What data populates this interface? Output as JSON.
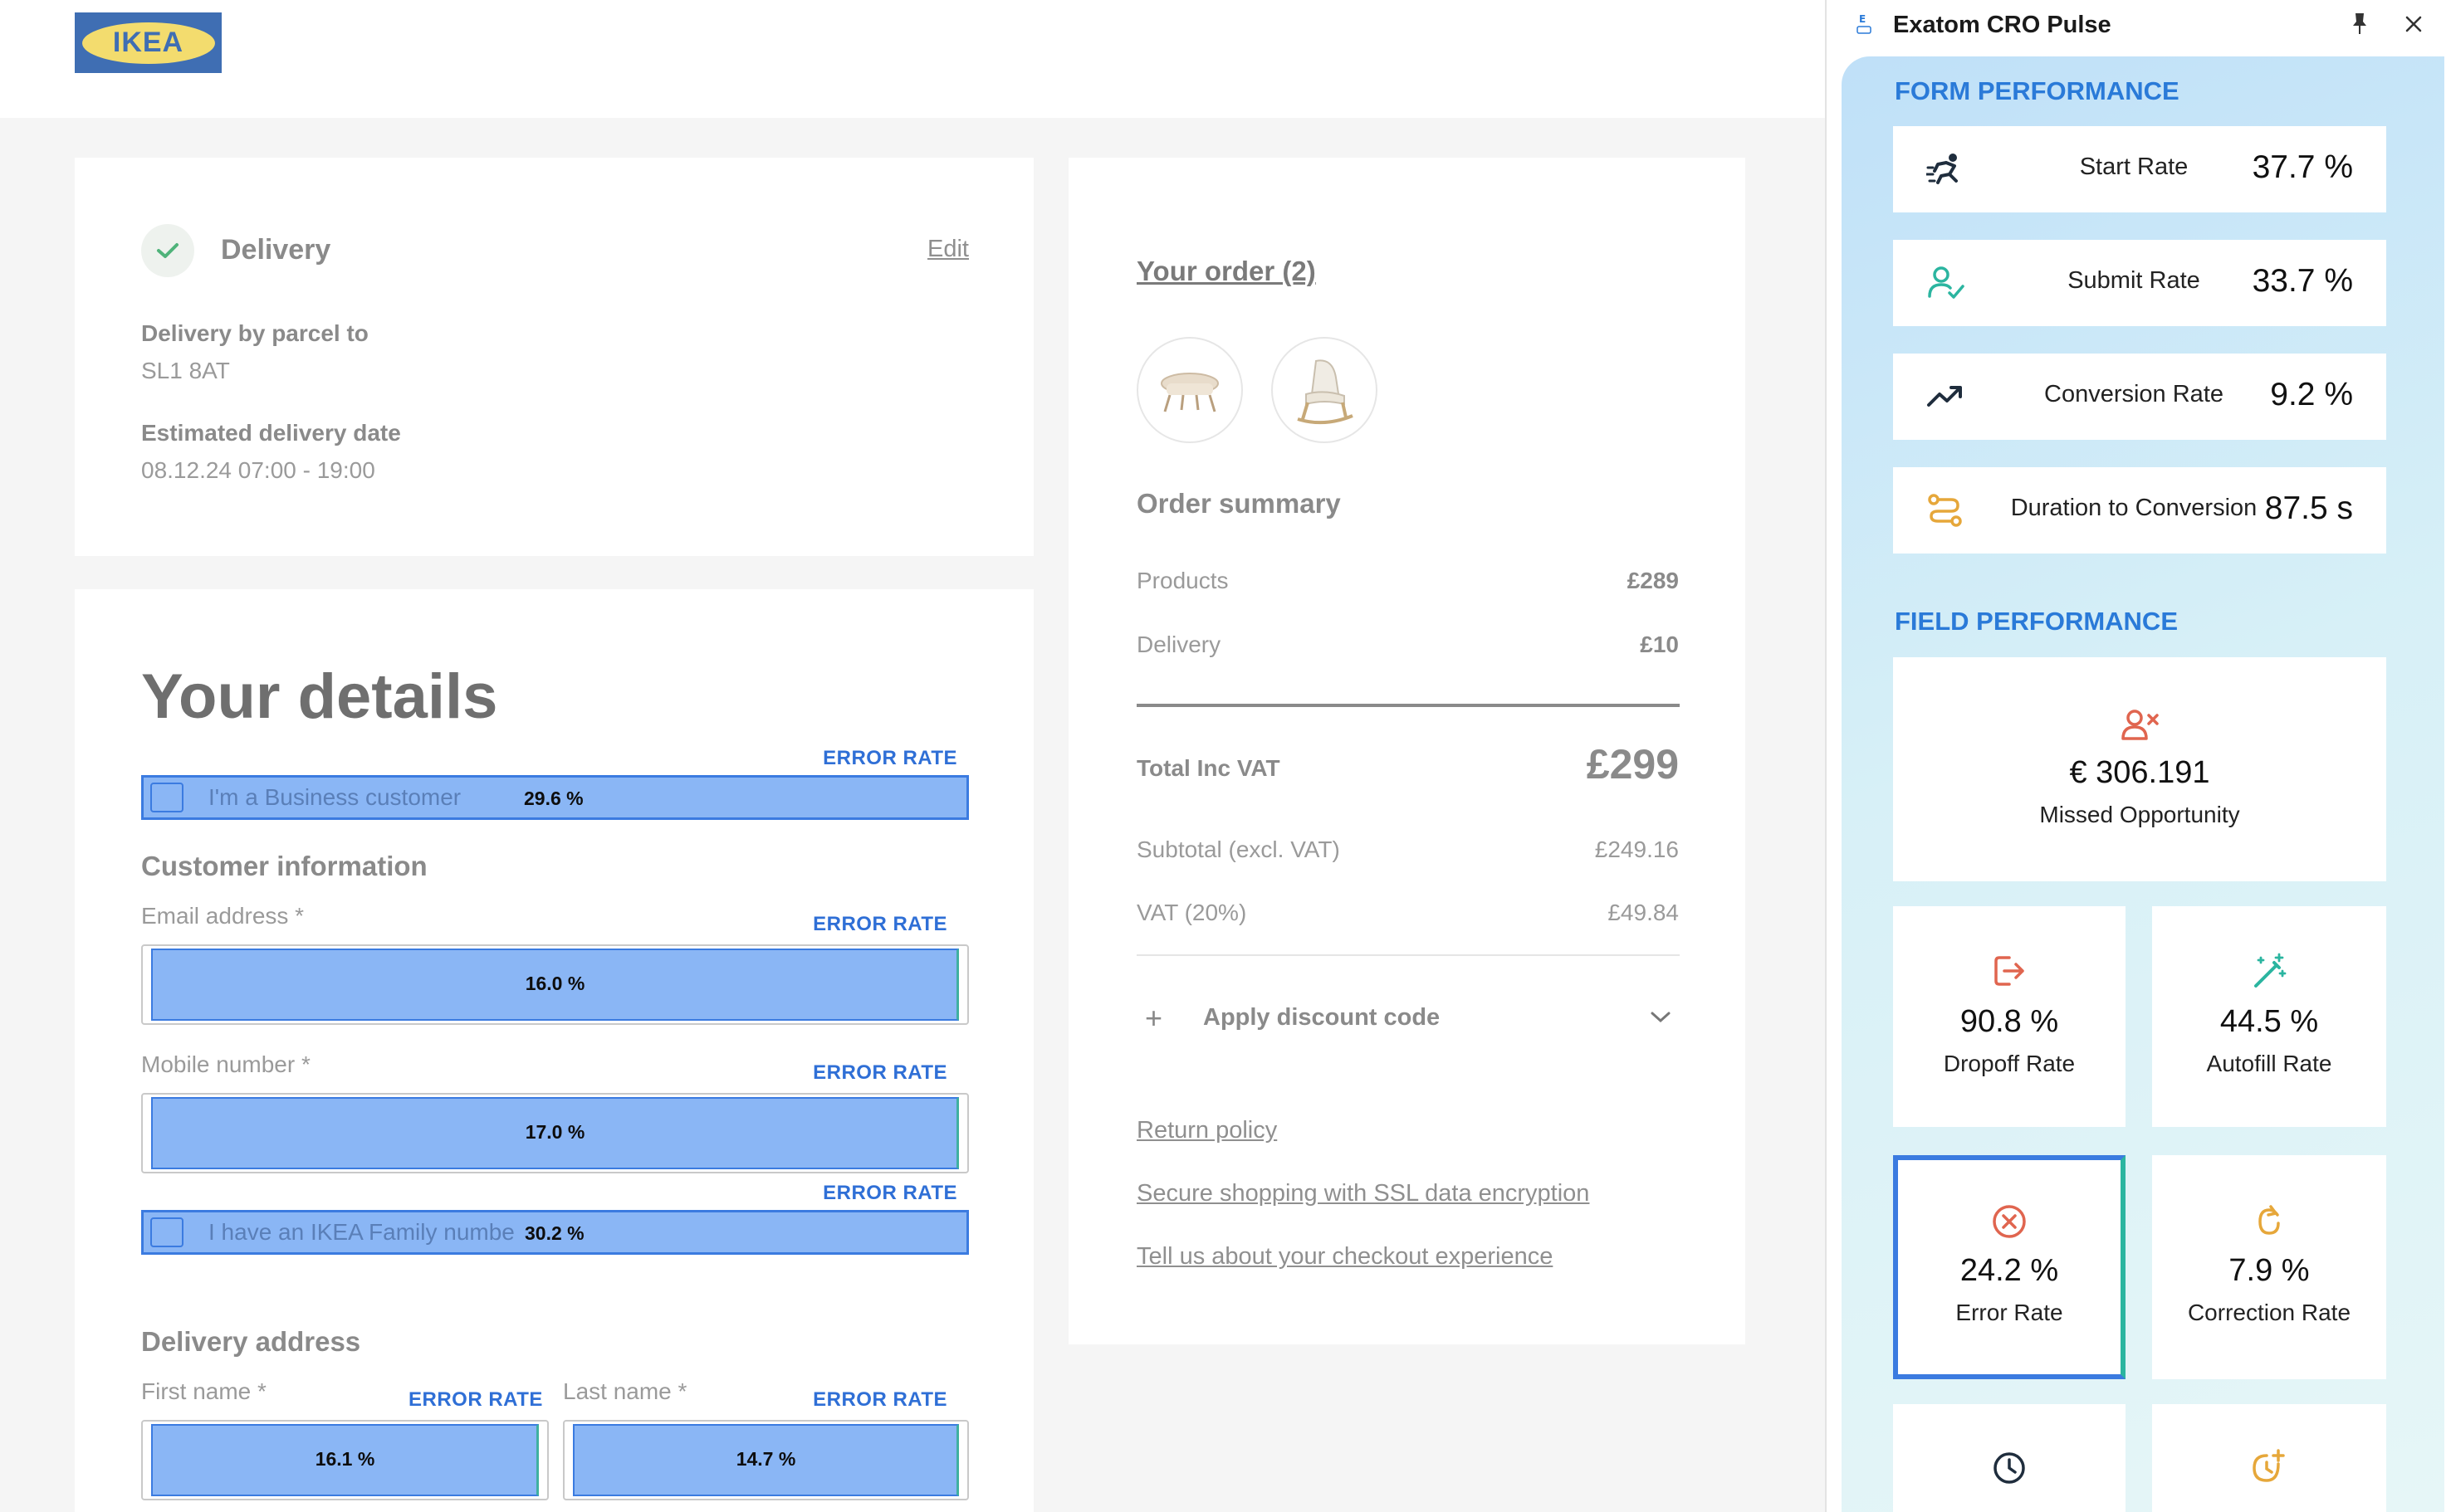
{
  "brand": {
    "logo_text": "IKEA",
    "colors": {
      "blue": "#3f6eb3",
      "yellow": "#f3dc6e"
    }
  },
  "delivery_card": {
    "title": "Delivery",
    "edit_link": "Edit",
    "parcel_label": "Delivery by parcel to",
    "postcode": "SL1 8AT",
    "estimate_label": "Estimated delivery date",
    "estimate_value": "08.12.24 07:00 - 19:00"
  },
  "details_card": {
    "title": "Your details",
    "business_checkbox": {
      "label": "I'm a Business customer",
      "error_label": "ERROR RATE",
      "error_rate": "29.6 %"
    },
    "customer_info_title": "Customer information",
    "email": {
      "label": "Email address *",
      "error_label": "ERROR RATE",
      "error_rate": "16.0 %"
    },
    "mobile": {
      "label": "Mobile number *",
      "error_label": "ERROR RATE",
      "error_rate": "17.0 %"
    },
    "family_checkbox": {
      "label": "I have an IKEA Family numbe",
      "error_label": "ERROR RATE",
      "error_rate": "30.2 %"
    },
    "delivery_address_title": "Delivery address",
    "first_name": {
      "label": "First name *",
      "error_label": "ERROR RATE",
      "error_rate": "16.1 %"
    },
    "last_name": {
      "label": "Last name *",
      "error_label": "ERROR RATE",
      "error_rate": "14.7 %"
    }
  },
  "order_card": {
    "your_order": "Your order (2)",
    "thumbnails": [
      "footstool-icon",
      "rocking-chair-icon"
    ],
    "summary_title": "Order summary",
    "products_label": "Products",
    "products_value": "£289",
    "delivery_label": "Delivery",
    "delivery_value": "£10",
    "total_label": "Total Inc VAT",
    "total_value": "£299",
    "subtotal_label": "Subtotal (excl. VAT)",
    "subtotal_value": "£249.16",
    "vat_label": "VAT (20%)",
    "vat_value": "£49.84",
    "discount_label": "Apply discount code",
    "links": [
      "Return policy",
      "Secure shopping with SSL data encryption",
      "Tell us about your checkout experience"
    ]
  },
  "panel": {
    "title": "Exatom CRO Pulse",
    "form_performance_title": "FORM PERFORMANCE",
    "form_metrics": [
      {
        "icon": "runner-icon",
        "name": "Start Rate",
        "value": "37.7 %"
      },
      {
        "icon": "user-check-icon",
        "name": "Submit Rate",
        "value": "33.7 %"
      },
      {
        "icon": "trend-up-icon",
        "name": "Conversion Rate",
        "value": "9.2 %"
      },
      {
        "icon": "route-icon",
        "name": "Duration to Conversion",
        "value": "87.5 s"
      }
    ],
    "field_performance_title": "FIELD PERFORMANCE",
    "missed_opportunity": {
      "icon": "user-x-icon",
      "value": "€ 306.191",
      "name": "Missed Opportunity"
    },
    "tiles": [
      {
        "icon": "exit-icon",
        "value": "90.8 %",
        "name": "Dropoff Rate"
      },
      {
        "icon": "magic-wand-icon",
        "value": "44.5 %",
        "name": "Autofill Rate"
      },
      {
        "icon": "error-circle-icon",
        "value": "24.2 %",
        "name": "Error Rate"
      },
      {
        "icon": "refresh-icon",
        "value": "7.9 %",
        "name": "Correction Rate"
      }
    ],
    "bottom_icons": [
      "clock-icon",
      "clock-plus-icon"
    ],
    "colors": {
      "accent": "#2a7ad8",
      "selected_border": "#3b7be0",
      "error_red": "#e0654f",
      "green": "#2bb5a0"
    }
  }
}
